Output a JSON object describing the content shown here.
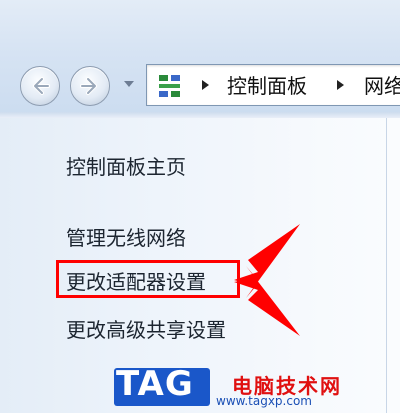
{
  "breadcrumb": {
    "items": [
      "控制面板",
      "网络"
    ]
  },
  "tasks": [
    {
      "label": "控制面板主页"
    },
    {
      "label": "管理无线网络"
    },
    {
      "label": "更改适配器设置"
    },
    {
      "label": "更改高级共享设置"
    }
  ],
  "annotation": {
    "highlight_color": "#ff0000",
    "target": "更改适配器设置"
  },
  "watermark": {
    "logo": "TAG",
    "title": "电脑技术网",
    "url": "www.tagxp.com"
  },
  "icons": [
    "back-arrow-icon",
    "forward-arrow-icon",
    "recent-pages-dropdown-icon",
    "control-panel-icon",
    "breadcrumb-separator-icon"
  ]
}
